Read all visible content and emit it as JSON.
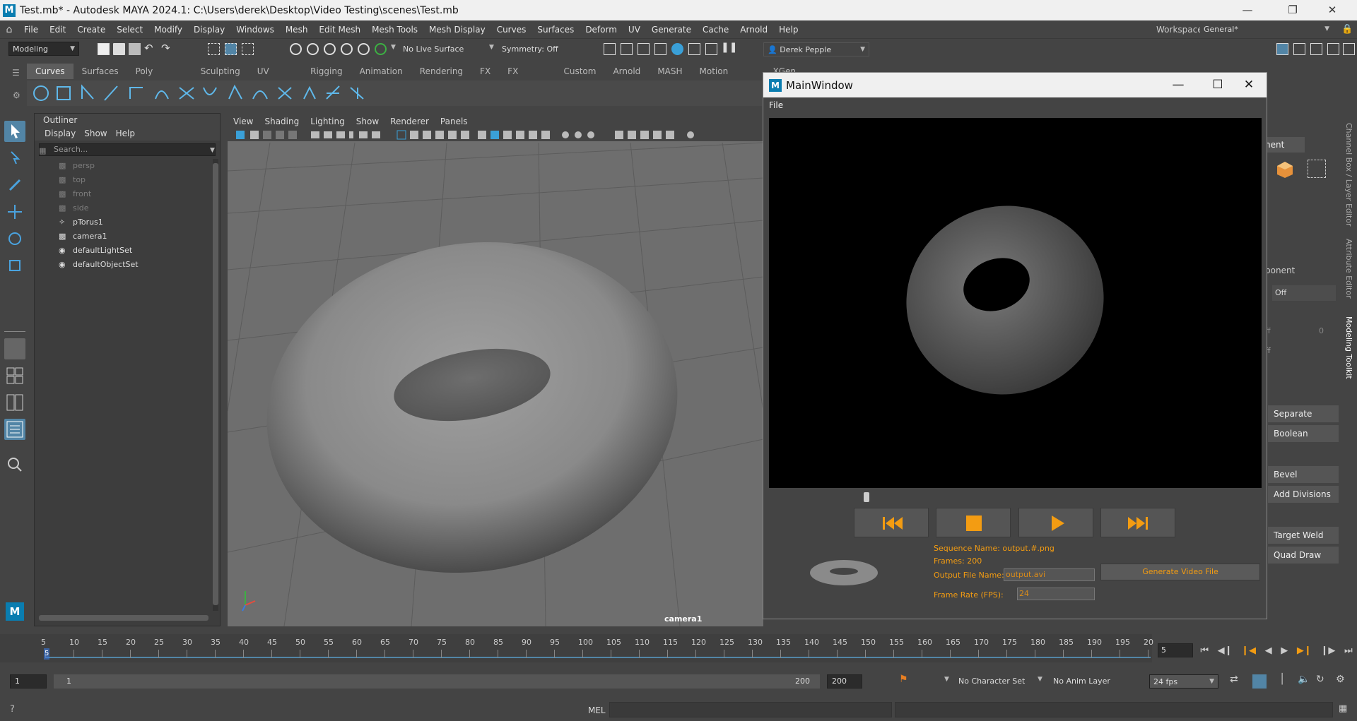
{
  "window": {
    "title": "Test.mb* - Autodesk MAYA 2024.1: C:\\Users\\derek\\Desktop\\Video Testing\\scenes\\Test.mb",
    "logo": "M"
  },
  "menubar": {
    "items": [
      "File",
      "Edit",
      "Create",
      "Select",
      "Modify",
      "Display",
      "Windows",
      "Mesh",
      "Edit Mesh",
      "Mesh Tools",
      "Mesh Display",
      "Curves",
      "Surfaces",
      "Deform",
      "UV",
      "Generate",
      "Cache",
      "Arnold",
      "Help"
    ],
    "workspace_label": "Workspace:",
    "workspace_value": "General*"
  },
  "statusline": {
    "menuset": "Modeling",
    "live_surface": "No Live Surface",
    "symmetry": "Symmetry: Off",
    "user": "Derek Pepple"
  },
  "shelf": {
    "tabs": [
      "Curves",
      "Surfaces",
      "Poly Modeling",
      "Sculpting",
      "UV Editing",
      "Rigging",
      "Animation",
      "Rendering",
      "FX",
      "FX Caching",
      "Custom",
      "Arnold",
      "MASH",
      "Motion Graphics",
      "XGen"
    ],
    "active_tab": "Curves"
  },
  "outliner": {
    "title": "Outliner",
    "menu": [
      "Display",
      "Show",
      "Help"
    ],
    "search_placeholder": "Search...",
    "items": [
      {
        "label": "persp",
        "icon": "camera-icon",
        "dim": true
      },
      {
        "label": "top",
        "icon": "camera-icon",
        "dim": true
      },
      {
        "label": "front",
        "icon": "camera-icon",
        "dim": true
      },
      {
        "label": "side",
        "icon": "camera-icon",
        "dim": true
      },
      {
        "label": "pTorus1",
        "icon": "mesh-transform-icon",
        "dim": false
      },
      {
        "label": "camera1",
        "icon": "camera-icon",
        "dim": false
      },
      {
        "label": "defaultLightSet",
        "icon": "set-icon",
        "dim": false
      },
      {
        "label": "defaultObjectSet",
        "icon": "set-icon",
        "dim": false
      }
    ]
  },
  "viewport": {
    "menu": [
      "View",
      "Shading",
      "Lighting",
      "Show",
      "Renderer",
      "Panels"
    ],
    "camera_label": "camera1"
  },
  "right_panel": {
    "buttons": [
      "Separate",
      "Boolean",
      "Bevel",
      "Add Divisions",
      "Target Weld",
      "Quad Draw"
    ],
    "partial_labels": [
      "nent",
      "ponent",
      "Off",
      "ff",
      "0",
      "ff"
    ],
    "vertical_tabs": [
      "Channel Box / Layer Editor",
      "Attribute Editor",
      "Modeling Toolkit"
    ]
  },
  "main_window": {
    "title": "MainWindow",
    "menu": [
      "File"
    ],
    "sequence_name": "Sequence Name: output.#.png",
    "frames": "Frames: 200",
    "output_label": "Output File Name:",
    "output_value": "output.avi",
    "fps_label": "Frame Rate (FPS):",
    "fps_value": "24",
    "generate_label": "Generate Video File",
    "playback_position": 0.0,
    "accent_color": "#f39c12"
  },
  "timeline": {
    "ticks": [
      "5",
      "10",
      "15",
      "20",
      "25",
      "30",
      "35",
      "40",
      "45",
      "50",
      "55",
      "60",
      "65",
      "70",
      "75",
      "80",
      "85",
      "90",
      "95",
      "100",
      "105",
      "110",
      "115",
      "120",
      "125",
      "130",
      "135",
      "140",
      "145",
      "150",
      "155",
      "160",
      "165",
      "170",
      "175",
      "180",
      "185",
      "190",
      "195",
      "20"
    ],
    "current_marker": "5",
    "current_frame": "5"
  },
  "range": {
    "start": "1",
    "inner_start": "1",
    "inner_end": "200",
    "end": "200",
    "char_set": "No Character Set",
    "anim_layer": "No Anim Layer",
    "fps": "24 fps"
  },
  "commandline": {
    "mode": "MEL"
  }
}
